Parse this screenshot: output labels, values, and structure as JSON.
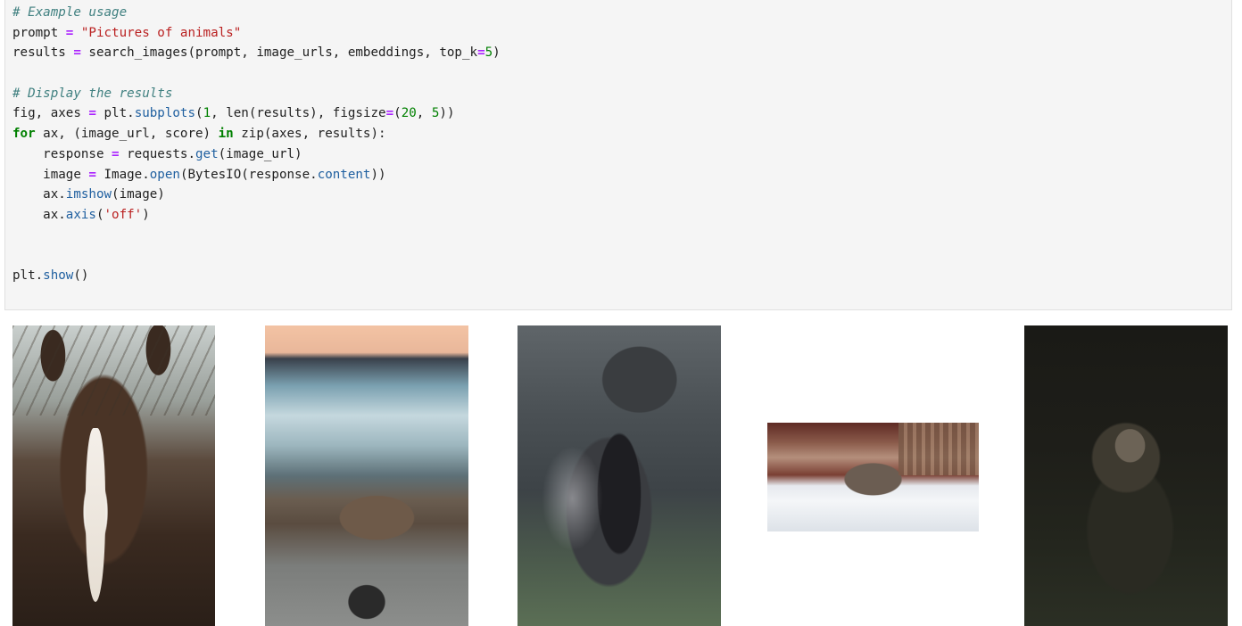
{
  "code_cell": {
    "lines": [
      [
        {
          "t": "# Example usage",
          "c": "cm"
        }
      ],
      [
        {
          "t": "prompt "
        },
        {
          "t": "=",
          "c": "op"
        },
        {
          "t": " "
        },
        {
          "t": "\"Pictures of animals\"",
          "c": "str"
        }
      ],
      [
        {
          "t": "results "
        },
        {
          "t": "=",
          "c": "op"
        },
        {
          "t": " search_images(prompt, image_urls, embeddings, top_k"
        },
        {
          "t": "=",
          "c": "op"
        },
        {
          "t": "5",
          "c": "num"
        },
        {
          "t": ")"
        }
      ],
      [],
      [
        {
          "t": "# Display the results",
          "c": "cm"
        }
      ],
      [
        {
          "t": "fig, axes "
        },
        {
          "t": "=",
          "c": "op"
        },
        {
          "t": " plt."
        },
        {
          "t": "subplots",
          "c": "attr"
        },
        {
          "t": "("
        },
        {
          "t": "1",
          "c": "num"
        },
        {
          "t": ", len(results), figsize"
        },
        {
          "t": "=",
          "c": "op"
        },
        {
          "t": "("
        },
        {
          "t": "20",
          "c": "num"
        },
        {
          "t": ", "
        },
        {
          "t": "5",
          "c": "num"
        },
        {
          "t": "))"
        }
      ],
      [
        {
          "t": "for",
          "c": "kw"
        },
        {
          "t": " ax, (image_url, score) "
        },
        {
          "t": "in",
          "c": "kw"
        },
        {
          "t": " zip(axes, results):"
        }
      ],
      [
        {
          "t": "    response "
        },
        {
          "t": "=",
          "c": "op"
        },
        {
          "t": " requests."
        },
        {
          "t": "get",
          "c": "attr"
        },
        {
          "t": "(image_url)"
        }
      ],
      [
        {
          "t": "    image "
        },
        {
          "t": "=",
          "c": "op"
        },
        {
          "t": " Image."
        },
        {
          "t": "open",
          "c": "attr"
        },
        {
          "t": "(BytesIO(response."
        },
        {
          "t": "content",
          "c": "attr"
        },
        {
          "t": "))"
        }
      ],
      [
        {
          "t": "    ax."
        },
        {
          "t": "imshow",
          "c": "attr"
        },
        {
          "t": "(image)"
        }
      ],
      [
        {
          "t": "    ax."
        },
        {
          "t": "axis",
          "c": "attr"
        },
        {
          "t": "("
        },
        {
          "t": "'off'",
          "c": "str"
        },
        {
          "t": ")"
        }
      ],
      [],
      [],
      [
        {
          "t": "plt."
        },
        {
          "t": "show",
          "c": "attr"
        },
        {
          "t": "()"
        }
      ]
    ]
  },
  "output": {
    "images": [
      {
        "name": "horse-image"
      },
      {
        "name": "seal-image"
      },
      {
        "name": "pony-image"
      },
      {
        "name": "rhino-image"
      },
      {
        "name": "baboon-image"
      }
    ]
  }
}
